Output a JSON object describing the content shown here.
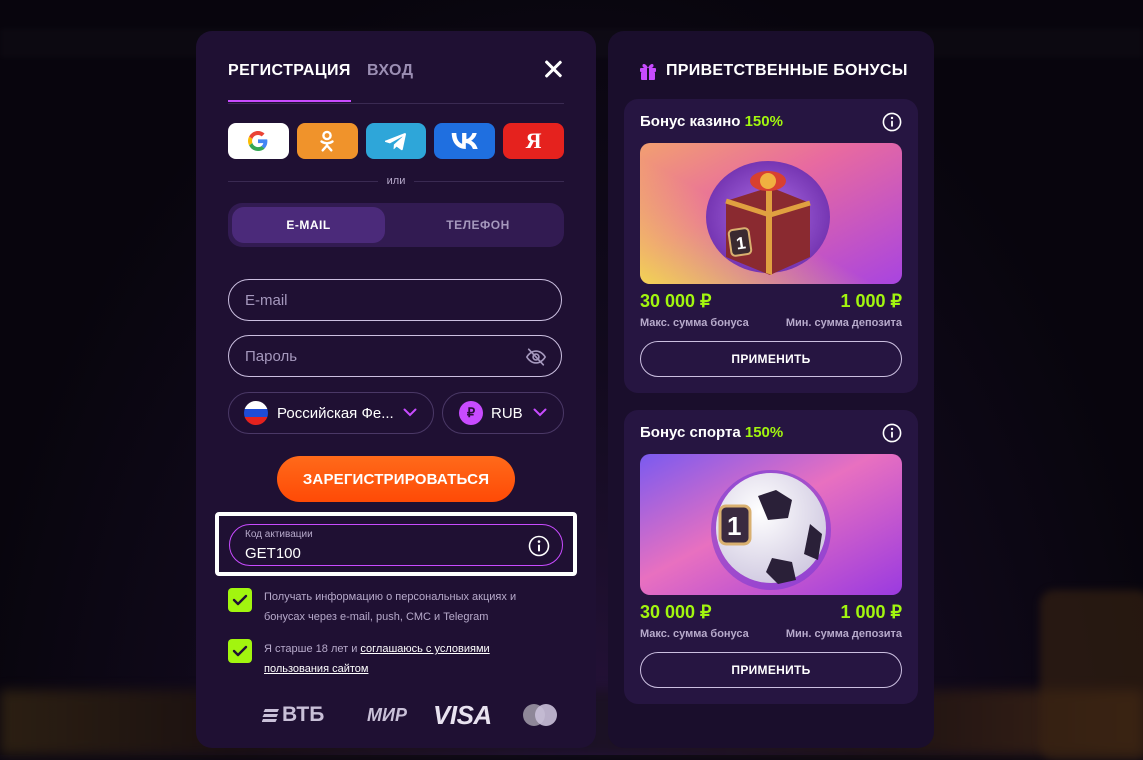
{
  "registration": {
    "tabs": [
      {
        "label": "РЕГИСТРАЦИЯ",
        "active": true
      },
      {
        "label": "ВХОД",
        "active": false
      }
    ],
    "socials": [
      "google-icon",
      "odnoklassniki-icon",
      "telegram-icon",
      "vk-icon",
      "yandex-icon"
    ],
    "yandex_glyph": "Я",
    "or_label": "или",
    "method_tabs": [
      {
        "label": "E-MAIL",
        "active": true
      },
      {
        "label": "ТЕЛЕФОН",
        "active": false
      }
    ],
    "email_placeholder": "E-mail",
    "password_placeholder": "Пароль",
    "country": "Российская Фе...",
    "currency": "RUB",
    "currency_symbol": "₽",
    "submit_label": "ЗАРЕГИСТРИРОВАТЬСЯ",
    "promo": {
      "label": "Код активации",
      "value": "GET100"
    },
    "consent_news": "Получать информацию о персональных акциях и бонусах через e-mail, push, СМС и Telegram",
    "consent_age_prefix": "Я старше 18 лет и ",
    "consent_age_link": "соглашаюсь с условиями пользования сайтом",
    "payments": {
      "vtb": "ВТБ",
      "mir": "МИР",
      "visa": "VISA"
    }
  },
  "bonuses": {
    "title": "ПРИВЕТСТВЕННЫЕ БОНУСЫ",
    "cards": [
      {
        "title": "Бонус казино",
        "percent": "150%",
        "max_amount": "30 000 ₽",
        "max_label": "Макс. сумма бонуса",
        "min_amount": "1 000 ₽",
        "min_label": "Мин. сумма депозита",
        "apply_label": "ПРИМЕНИТЬ",
        "badge": "1"
      },
      {
        "title": "Бонус спорта",
        "percent": "150%",
        "max_amount": "30 000 ₽",
        "max_label": "Макс. сумма бонуса",
        "min_amount": "1 000 ₽",
        "min_label": "Мин. сумма депозита",
        "apply_label": "ПРИМЕНИТЬ",
        "badge": "1"
      }
    ]
  },
  "colors": {
    "accent_green": "#a2f50f",
    "accent_purple": "#c84bff",
    "cta_orange": "#ff5a0c",
    "panel_bg": "#1f1033"
  }
}
